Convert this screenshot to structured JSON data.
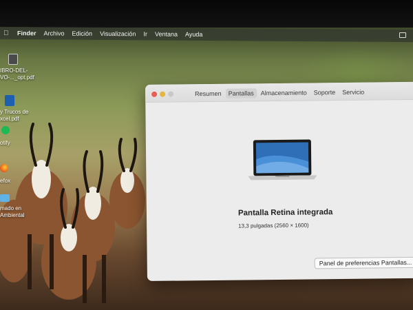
{
  "menubar": {
    "items": [
      "Finder",
      "Archivo",
      "Edición",
      "Visualización",
      "Ir",
      "Ventana",
      "Ayuda"
    ]
  },
  "desktop": {
    "items": [
      {
        "line1": "IBRO-DEL-",
        "line2": "VO-..._opt.pdf",
        "icon": "pdf-file-icon"
      },
      {
        "line1": "y Trucos de",
        "line2": "xcel.pdf",
        "icon": "pdf-file-icon"
      },
      {
        "line1": "otify",
        "line2": "",
        "icon": "spotify-icon"
      },
      {
        "line1": "efox",
        "line2": "",
        "icon": "firefox-icon"
      },
      {
        "line1": "mado en",
        "line2": "Ambiental",
        "icon": "folder-icon"
      }
    ]
  },
  "window": {
    "tabs": [
      "Resumen",
      "Pantallas",
      "Almacenamiento",
      "Soporte",
      "Servicio"
    ],
    "active_tab": "Pantallas",
    "display_name": "Pantalla Retina integrada",
    "display_detail": "13,3 pulgadas (2560 × 1600)",
    "prefs_button": "Panel de preferencias Pantallas..."
  }
}
